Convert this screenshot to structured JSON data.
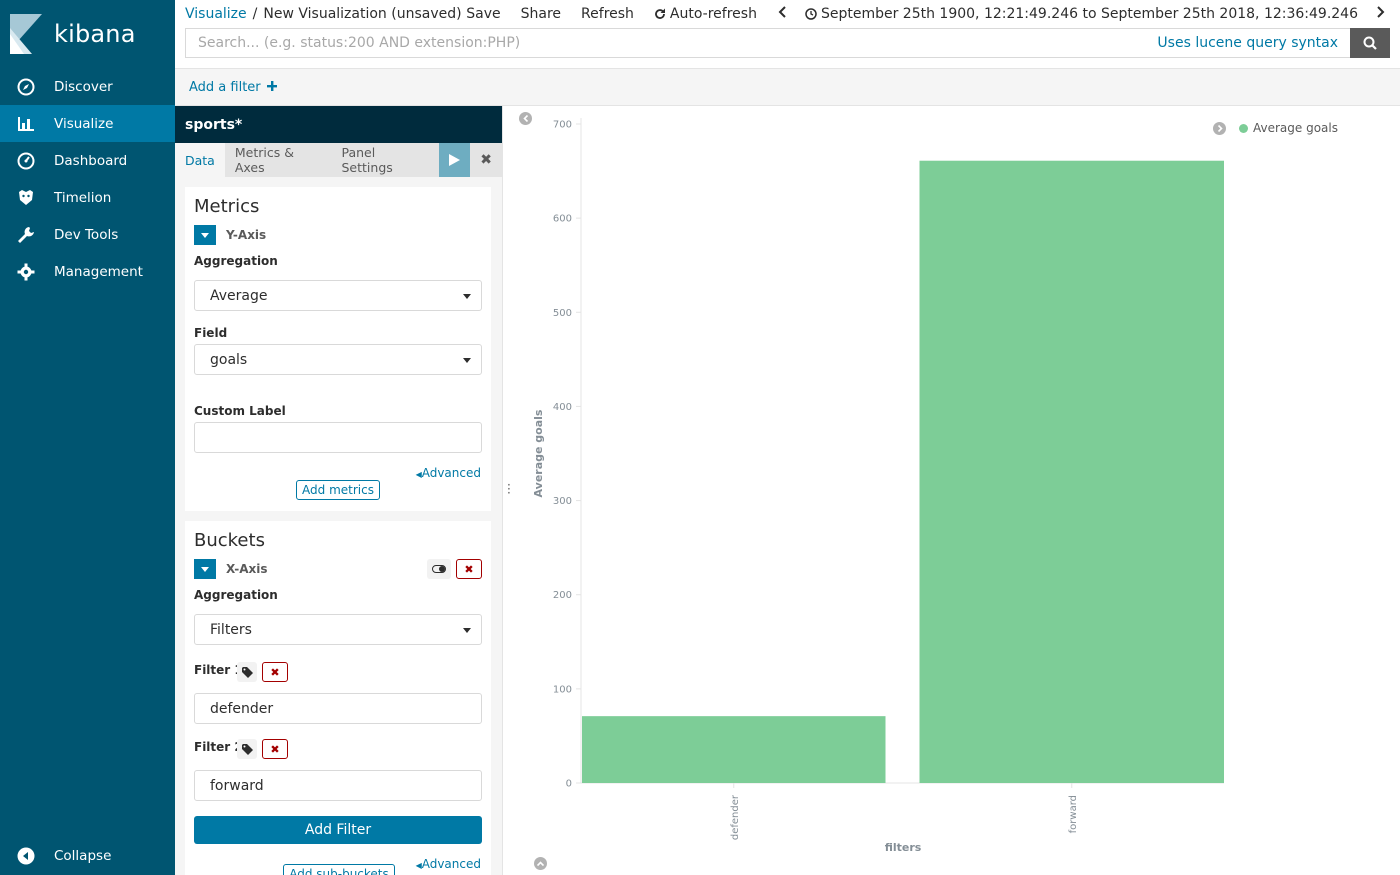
{
  "app": {
    "logo_text": "kibana"
  },
  "sidebar": {
    "items": [
      {
        "label": "Discover",
        "icon": "compass-icon"
      },
      {
        "label": "Visualize",
        "icon": "bar-chart-icon"
      },
      {
        "label": "Dashboard",
        "icon": "gauge-icon"
      },
      {
        "label": "Timelion",
        "icon": "timelion-icon"
      },
      {
        "label": "Dev Tools",
        "icon": "wrench-icon"
      },
      {
        "label": "Management",
        "icon": "gear-icon"
      }
    ],
    "active_index": 1,
    "collapse_label": "Collapse"
  },
  "breadcrumb": {
    "root": "Visualize",
    "separator": "/",
    "current": "New Visualization (unsaved)"
  },
  "top_menu": {
    "save": "Save",
    "share": "Share",
    "refresh": "Refresh",
    "auto_refresh": "Auto-refresh",
    "time_range": "September 25th 1900, 12:21:49.246 to September 25th 2018, 12:36:49.246"
  },
  "search": {
    "placeholder": "Search... (e.g. status:200 AND extension:PHP)",
    "syntax_link": "Uses lucene query syntax"
  },
  "filter_bar": {
    "add_filter": "Add a filter"
  },
  "editor": {
    "index_pattern": "sports*",
    "tabs": [
      "Data",
      "Metrics & Axes",
      "Panel Settings"
    ],
    "active_tab": 0,
    "metrics": {
      "title": "Metrics",
      "axis_label": "Y-Axis",
      "aggregation_label": "Aggregation",
      "aggregation_value": "Average",
      "field_label": "Field",
      "field_value": "goals",
      "custom_label_label": "Custom Label",
      "custom_label_value": "",
      "advanced": "Advanced",
      "add_metrics": "Add metrics"
    },
    "buckets": {
      "title": "Buckets",
      "axis_label": "X-Axis",
      "aggregation_label": "Aggregation",
      "aggregation_value": "Filters",
      "filter1_label": "Filter 1",
      "filter1_value": "defender",
      "filter2_label": "Filter 2",
      "filter2_value": "forward",
      "add_filter": "Add Filter",
      "advanced": "Advanced",
      "add_sub_buckets": "Add sub-buckets"
    }
  },
  "chart_data": {
    "type": "bar",
    "categories": [
      "defender",
      "forward"
    ],
    "series": [
      {
        "name": "Average goals",
        "values": [
          71,
          661
        ],
        "color": "#7dcd97"
      }
    ],
    "xlabel": "filters",
    "ylabel": "Average goals",
    "ylim": [
      0,
      700
    ],
    "yticks": [
      0,
      100,
      200,
      300,
      400,
      500,
      600,
      700
    ],
    "legend_position": "top-right",
    "grid": false
  }
}
